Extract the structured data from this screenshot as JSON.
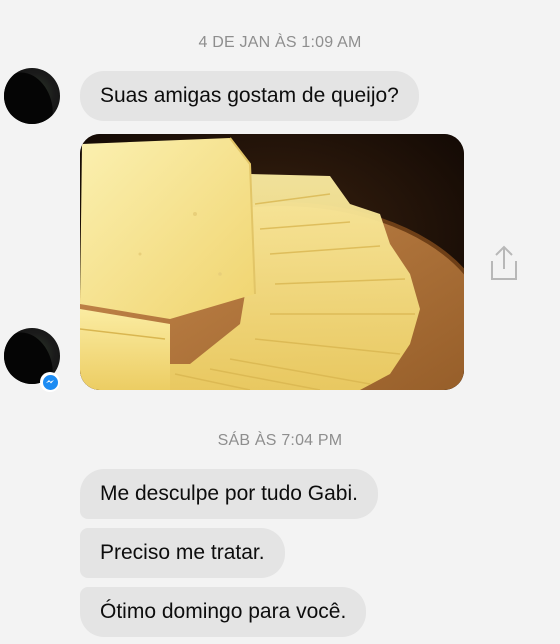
{
  "conversation": {
    "timestamp_1": "4 DE JAN ÀS 1:09 AM",
    "timestamp_2": "SÁB ÀS 7:04 PM",
    "messages": [
      {
        "text": "Suas amigas gostam de queijo?"
      },
      {
        "text": "Me desculpe por tudo Gabi."
      },
      {
        "text": "Preciso me tratar."
      },
      {
        "text": "Ótimo domingo para você."
      }
    ]
  },
  "icons": {
    "share": "share-icon",
    "messenger_badge": "messenger-badge-icon"
  },
  "colors": {
    "background": "#f3f3f3",
    "bubble": "#e4e4e4",
    "timestamp": "#8e8e8e",
    "messenger_blue": "#1d8cf3"
  }
}
